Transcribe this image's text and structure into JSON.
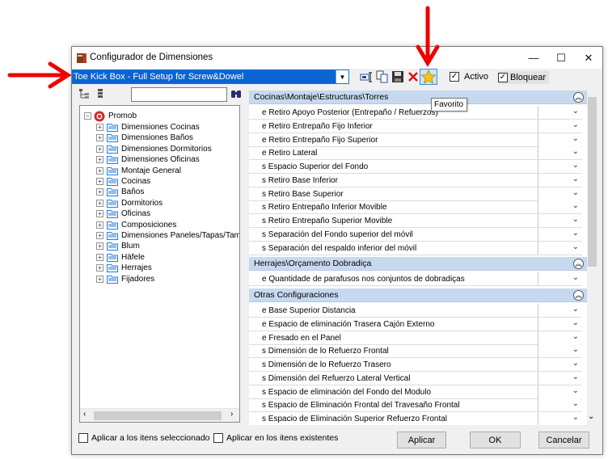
{
  "window": {
    "title": "Configurador de Dimensiones",
    "minimize": "—",
    "maximize": "☐",
    "close": "✕"
  },
  "toolbar": {
    "preset_value": "Toe Kick Box - Full Setup for Screw&Dowel",
    "activo_label": "Activo",
    "activo_checked": "✓",
    "bloquear_label": "Bloquear",
    "bloquear_checked": "✓",
    "favorite_tooltip": "Favorito"
  },
  "tree": {
    "root": "Promob",
    "items": [
      "Dimensiones Cocinas",
      "Dimensiones Baños",
      "Dimensiones Dormitorios",
      "Dimensiones Oficinas",
      "Montaje General",
      "Cocinas",
      "Baños",
      "Dormitorios",
      "Oficinas",
      "Composiciones",
      "Dimensiones Paneles/Tapas/Tambu",
      "Blum",
      "Häfele",
      "Herrajes",
      "Fijadores"
    ]
  },
  "grid": {
    "sections": [
      {
        "title": "Cocinas\\Montaje\\Estructuras\\Torres",
        "rows": [
          "e Retiro Apoyo Posterior (Entrepaño / Refuerzos)",
          "e Retiro Entrepaño Fijo Inferior",
          "e Retiro Entrepaño Fijo Superior",
          "e Retiro Lateral",
          "s Espacio Superior del Fondo",
          "s Retiro Base Inferior",
          "s Retiro Base Superior",
          "s Retiro Entrepaño Inferior Movible",
          "s Retiro Entrepaño Superior Movible",
          "s Separación del Fondo superior del móvil",
          "s Separación del respaldo inferior del móvil"
        ]
      },
      {
        "title": "Herrajes\\Orçamento Dobradiça",
        "rows": [
          "e Quantidade de parafusos nos conjuntos de dobradiças"
        ]
      },
      {
        "title": "Otras Configuraciones",
        "rows": [
          "e Base Superior Distancia",
          "e Espacio de eliminación Trasera Cajón Externo",
          "e Fresado en el Panel",
          "s Dimensión de lo Refuerzo Frontal",
          "s Dimensión de lo Refuerzo Trasero",
          "s Dimensión del Refuerzo Lateral Vertical",
          "s Espacio de eliminación del Fondo del Modulo",
          "s Espacio de Eliminación Frontal del Travesaño Frontal",
          "s Espacio de Eliminación Superior Refuerzo Frontal"
        ]
      }
    ]
  },
  "footer": {
    "apply_selected_label": "Aplicar a los itens seleccionado",
    "apply_existing_label": "Aplicar en los itens existentes",
    "apply_button": "Aplicar",
    "ok_button": "OK",
    "cancel_button": "Cancelar"
  },
  "colors": {
    "selection": "#0a64d2",
    "section_header": "#c7d9ef",
    "annotation_arrow": "#ef0000"
  }
}
